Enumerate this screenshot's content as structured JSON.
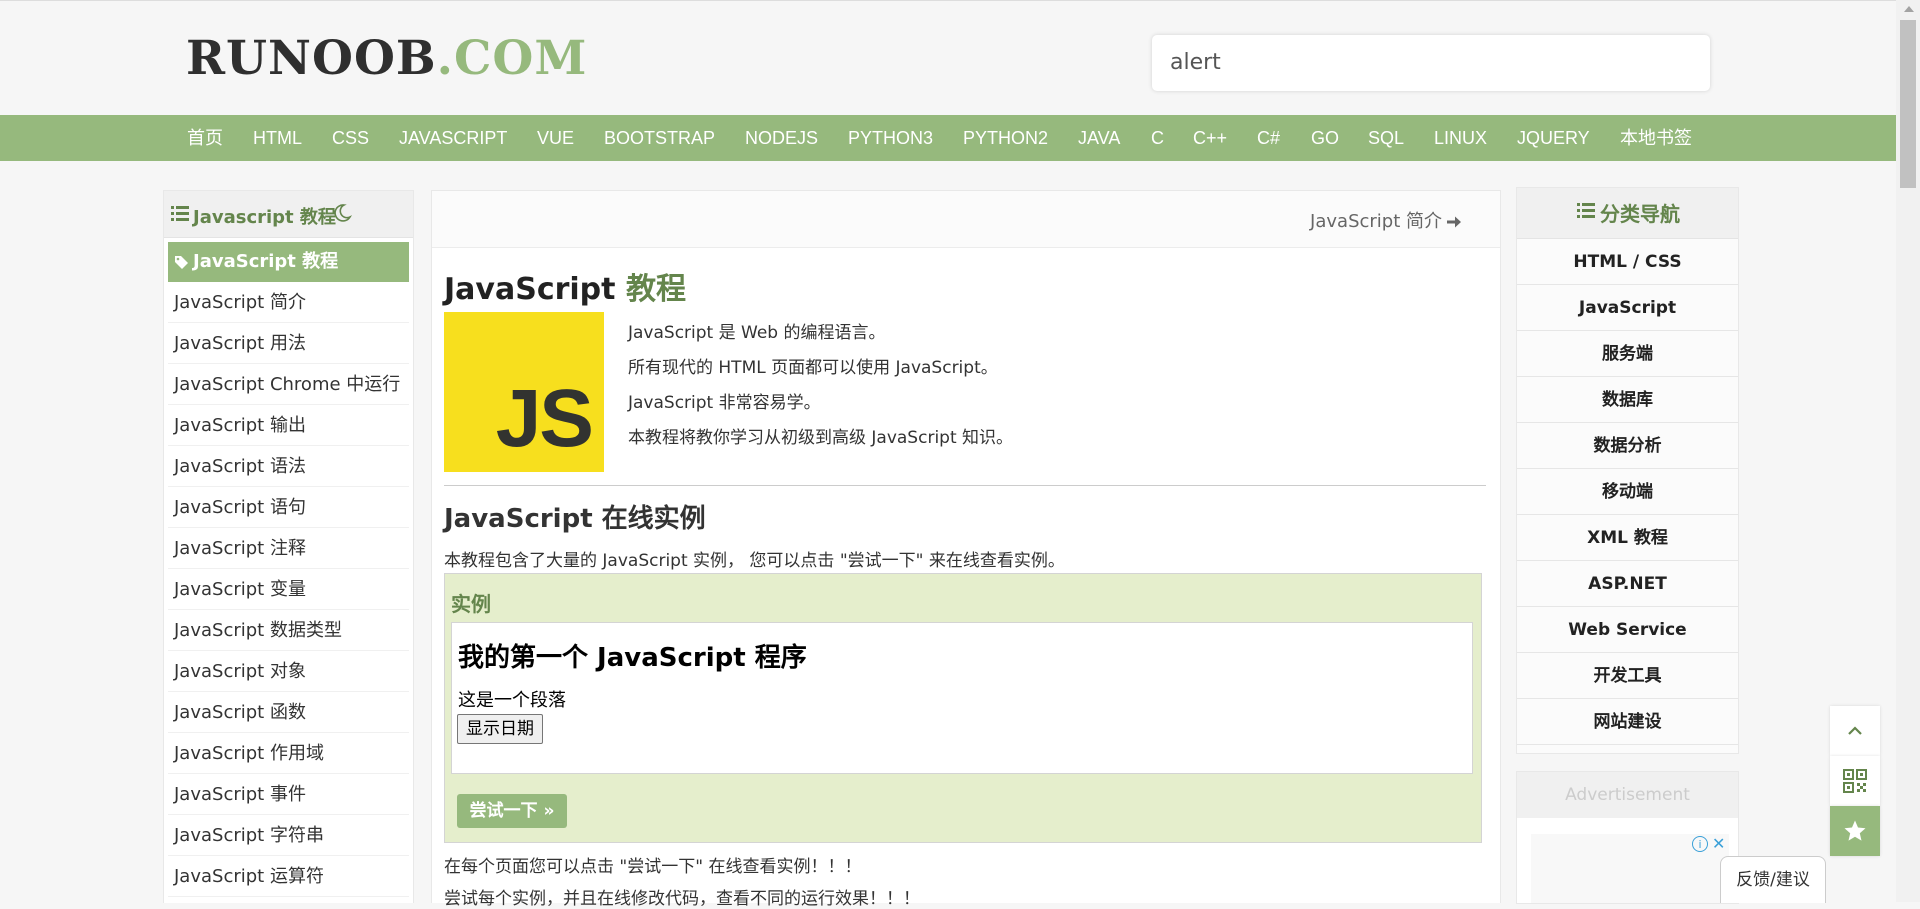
{
  "header": {
    "logo_main": "RUNOOB",
    "logo_suffix": ".COM",
    "search_value": "alert"
  },
  "nav": [
    "首页",
    "HTML",
    "CSS",
    "JAVASCRIPT",
    "VUE",
    "BOOTSTRAP",
    "NODEJS",
    "PYTHON3",
    "PYTHON2",
    "JAVA",
    "C",
    "C++",
    "C#",
    "GO",
    "SQL",
    "LINUX",
    "JQUERY",
    "本地书签"
  ],
  "left_sidebar": {
    "title": "Javascript 教程",
    "items": [
      "JavaScript 教程",
      "JavaScript 简介",
      "JavaScript 用法",
      "JavaScript Chrome 中运行",
      "JavaScript 输出",
      "JavaScript 语法",
      "JavaScript 语句",
      "JavaScript 注释",
      "JavaScript 变量",
      "JavaScript 数据类型",
      "JavaScript 对象",
      "JavaScript 函数",
      "JavaScript 作用域",
      "JavaScript 事件",
      "JavaScript 字符串",
      "JavaScript 运算符"
    ]
  },
  "main": {
    "next_link": "JavaScript 简介",
    "title_prefix": "JavaScript",
    "title_suffix": " 教程",
    "logo_text": "JS",
    "intro": [
      "JavaScript 是 Web 的编程语言。",
      "所有现代的 HTML 页面都可以使用 JavaScript。",
      "JavaScript 非常容易学。",
      "本教程将教你学习从初级到高级 JavaScript 知识。"
    ],
    "section_title": "JavaScript 在线实例",
    "section_desc": "本教程包含了大量的 JavaScript 实例， 您可以点击 \"尝试一下\" 来在线查看实例。",
    "example": {
      "label": "实例",
      "heading": "我的第一个 JavaScript 程序",
      "paragraph": "这是一个段落",
      "button": "显示日期",
      "try_button": "尝试一下 »"
    },
    "footer_lines": [
      "在每个页面您可以点击 \"尝试一下\" 在线查看实例！！！",
      "尝试每个实例，并且在线修改代码，查看不同的运行效果！！！"
    ]
  },
  "right_sidebar": {
    "title": "分类导航",
    "items": [
      "HTML / CSS",
      "JavaScript",
      "服务端",
      "数据库",
      "数据分析",
      "移动端",
      "XML 教程",
      "ASP.NET",
      "Web Service",
      "开发工具",
      "网站建设"
    ],
    "ad_label": "Advertisement",
    "ad_info": "i",
    "ad_close": "✕"
  },
  "feedback": "反馈/建议",
  "colors": {
    "accent": "#96b97d",
    "accent_dark": "#64854c",
    "example_bg": "#e5eecc",
    "js_yellow": "#f7df1e"
  }
}
